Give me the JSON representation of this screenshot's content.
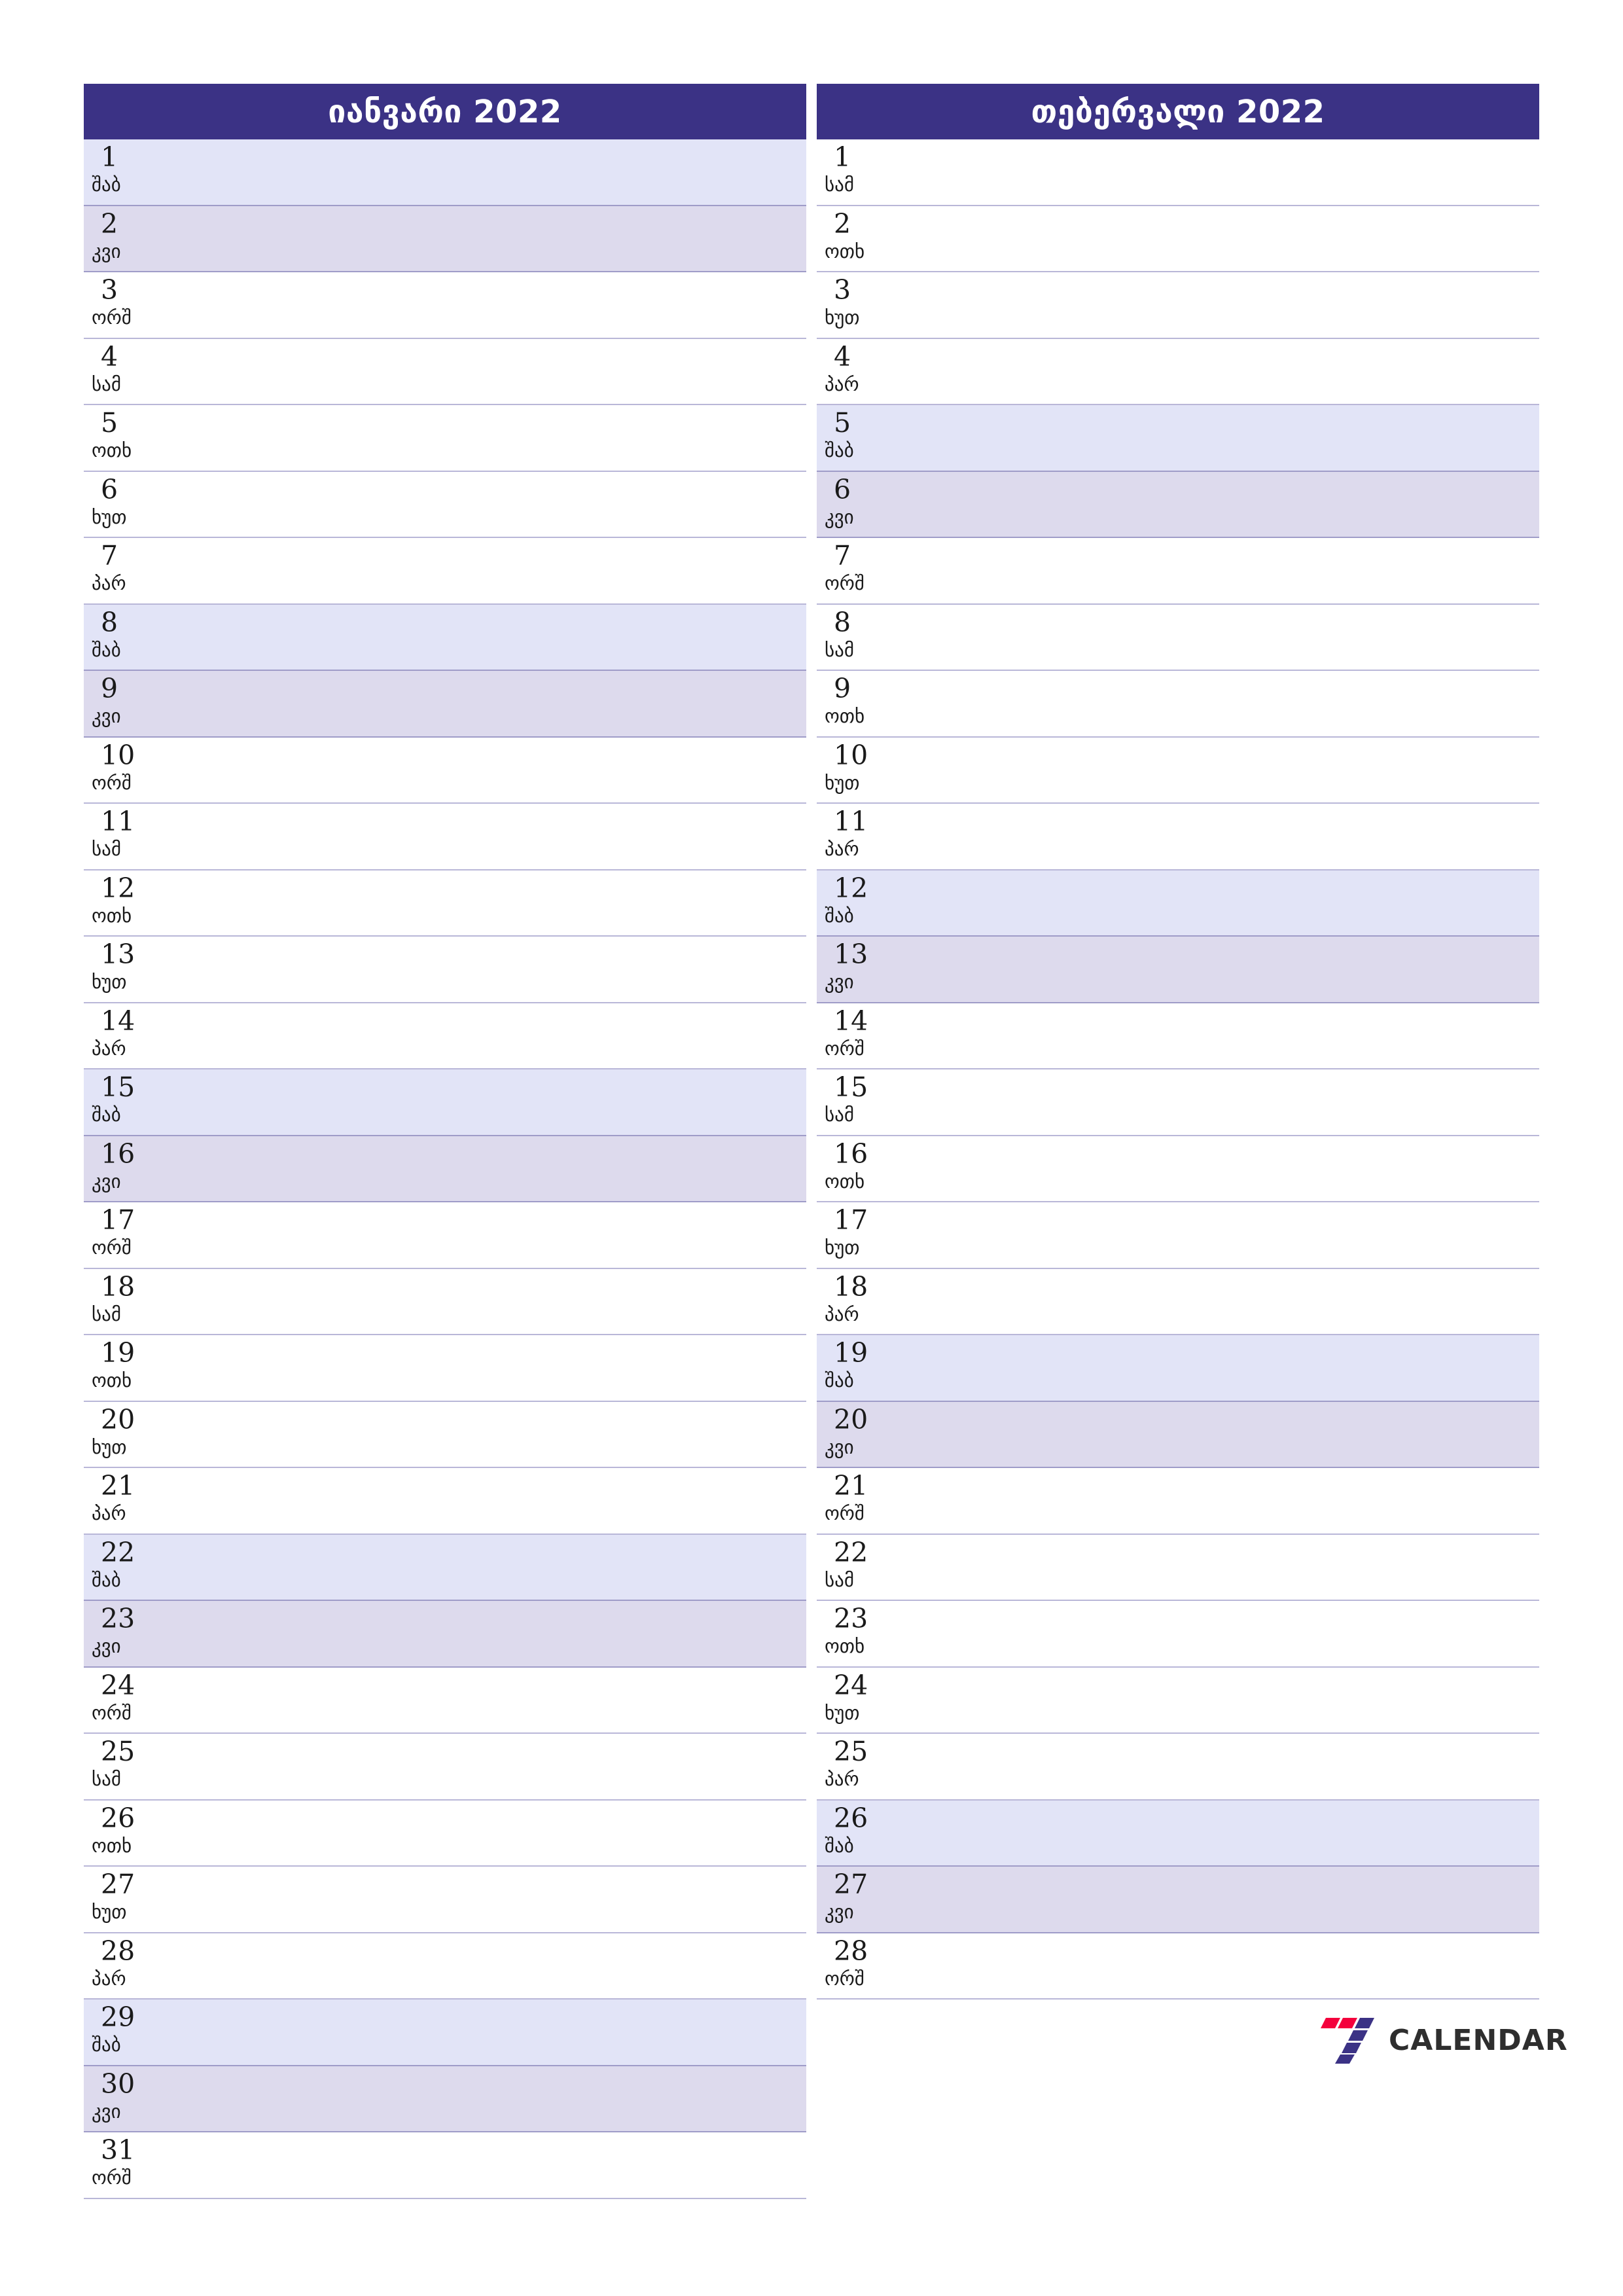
{
  "page": {
    "background": "#ffffff",
    "accent": "#3b3285",
    "saturday_color": "#e2e4f7",
    "sunday_color": "#dddaed",
    "border_color": "#b9b7d8"
  },
  "brand": {
    "word": "CALENDAR",
    "mark_red": "#f4003c",
    "mark_navy": "#3b3285",
    "word_color": "#2e2e2e"
  },
  "months": [
    {
      "title": "იანვარი 2022",
      "days": [
        {
          "num": "1",
          "wd": "შაბ",
          "type": "sat"
        },
        {
          "num": "2",
          "wd": "კვი",
          "type": "sun"
        },
        {
          "num": "3",
          "wd": "ორშ",
          "type": "weekday"
        },
        {
          "num": "4",
          "wd": "სამ",
          "type": "weekday"
        },
        {
          "num": "5",
          "wd": "ოთხ",
          "type": "weekday"
        },
        {
          "num": "6",
          "wd": "ხუთ",
          "type": "weekday"
        },
        {
          "num": "7",
          "wd": "პარ",
          "type": "weekday"
        },
        {
          "num": "8",
          "wd": "შაბ",
          "type": "sat"
        },
        {
          "num": "9",
          "wd": "კვი",
          "type": "sun"
        },
        {
          "num": "10",
          "wd": "ორშ",
          "type": "weekday"
        },
        {
          "num": "11",
          "wd": "სამ",
          "type": "weekday"
        },
        {
          "num": "12",
          "wd": "ოთხ",
          "type": "weekday"
        },
        {
          "num": "13",
          "wd": "ხუთ",
          "type": "weekday"
        },
        {
          "num": "14",
          "wd": "პარ",
          "type": "weekday"
        },
        {
          "num": "15",
          "wd": "შაბ",
          "type": "sat"
        },
        {
          "num": "16",
          "wd": "კვი",
          "type": "sun"
        },
        {
          "num": "17",
          "wd": "ორშ",
          "type": "weekday"
        },
        {
          "num": "18",
          "wd": "სამ",
          "type": "weekday"
        },
        {
          "num": "19",
          "wd": "ოთხ",
          "type": "weekday"
        },
        {
          "num": "20",
          "wd": "ხუთ",
          "type": "weekday"
        },
        {
          "num": "21",
          "wd": "პარ",
          "type": "weekday"
        },
        {
          "num": "22",
          "wd": "შაბ",
          "type": "sat"
        },
        {
          "num": "23",
          "wd": "კვი",
          "type": "sun"
        },
        {
          "num": "24",
          "wd": "ორშ",
          "type": "weekday"
        },
        {
          "num": "25",
          "wd": "სამ",
          "type": "weekday"
        },
        {
          "num": "26",
          "wd": "ოთხ",
          "type": "weekday"
        },
        {
          "num": "27",
          "wd": "ხუთ",
          "type": "weekday"
        },
        {
          "num": "28",
          "wd": "პარ",
          "type": "weekday"
        },
        {
          "num": "29",
          "wd": "შაბ",
          "type": "sat"
        },
        {
          "num": "30",
          "wd": "კვი",
          "type": "sun"
        },
        {
          "num": "31",
          "wd": "ორშ",
          "type": "weekday"
        }
      ]
    },
    {
      "title": "თებერვალი 2022",
      "days": [
        {
          "num": "1",
          "wd": "სამ",
          "type": "weekday"
        },
        {
          "num": "2",
          "wd": "ოთხ",
          "type": "weekday"
        },
        {
          "num": "3",
          "wd": "ხუთ",
          "type": "weekday"
        },
        {
          "num": "4",
          "wd": "პარ",
          "type": "weekday"
        },
        {
          "num": "5",
          "wd": "შაბ",
          "type": "sat"
        },
        {
          "num": "6",
          "wd": "კვი",
          "type": "sun"
        },
        {
          "num": "7",
          "wd": "ორშ",
          "type": "weekday"
        },
        {
          "num": "8",
          "wd": "სამ",
          "type": "weekday"
        },
        {
          "num": "9",
          "wd": "ოთხ",
          "type": "weekday"
        },
        {
          "num": "10",
          "wd": "ხუთ",
          "type": "weekday"
        },
        {
          "num": "11",
          "wd": "პარ",
          "type": "weekday"
        },
        {
          "num": "12",
          "wd": "შაბ",
          "type": "sat"
        },
        {
          "num": "13",
          "wd": "კვი",
          "type": "sun"
        },
        {
          "num": "14",
          "wd": "ორშ",
          "type": "weekday"
        },
        {
          "num": "15",
          "wd": "სამ",
          "type": "weekday"
        },
        {
          "num": "16",
          "wd": "ოთხ",
          "type": "weekday"
        },
        {
          "num": "17",
          "wd": "ხუთ",
          "type": "weekday"
        },
        {
          "num": "18",
          "wd": "პარ",
          "type": "weekday"
        },
        {
          "num": "19",
          "wd": "შაბ",
          "type": "sat"
        },
        {
          "num": "20",
          "wd": "კვი",
          "type": "sun"
        },
        {
          "num": "21",
          "wd": "ორშ",
          "type": "weekday"
        },
        {
          "num": "22",
          "wd": "სამ",
          "type": "weekday"
        },
        {
          "num": "23",
          "wd": "ოთხ",
          "type": "weekday"
        },
        {
          "num": "24",
          "wd": "ხუთ",
          "type": "weekday"
        },
        {
          "num": "25",
          "wd": "პარ",
          "type": "weekday"
        },
        {
          "num": "26",
          "wd": "შაბ",
          "type": "sat"
        },
        {
          "num": "27",
          "wd": "კვი",
          "type": "sun"
        },
        {
          "num": "28",
          "wd": "ორშ",
          "type": "weekday"
        }
      ]
    }
  ]
}
